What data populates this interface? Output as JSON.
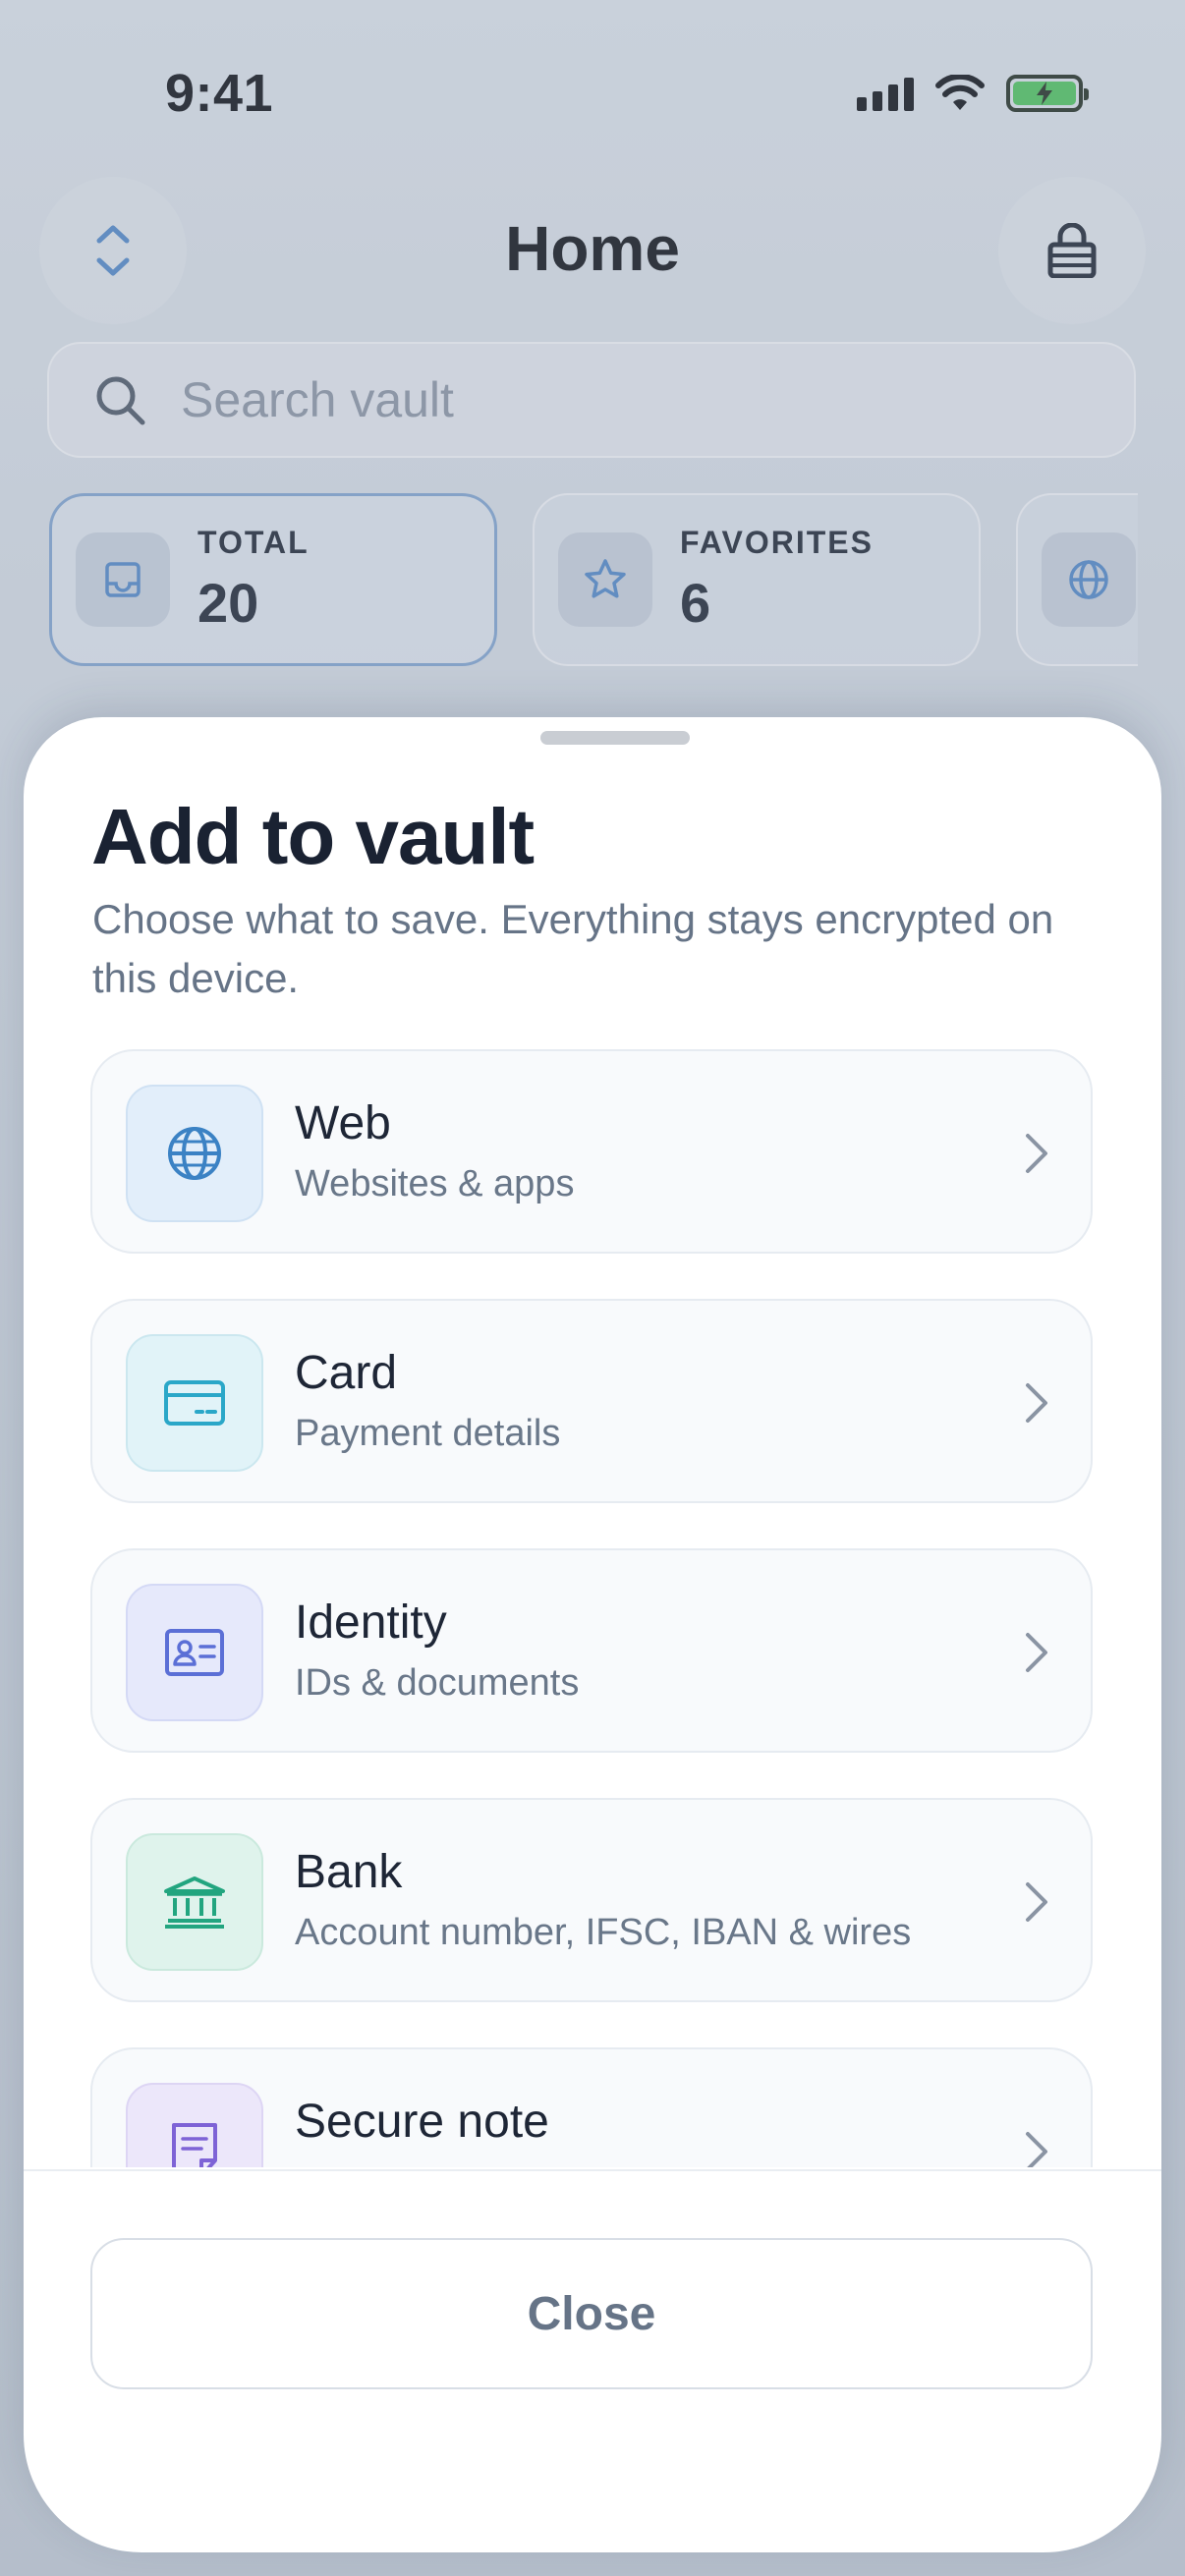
{
  "status_bar": {
    "time": "9:41"
  },
  "header": {
    "title": "Home"
  },
  "search": {
    "placeholder": "Search vault"
  },
  "stats": [
    {
      "label": "TOTAL",
      "value": "20"
    },
    {
      "label": "FAVORITES",
      "value": "6"
    }
  ],
  "sheet": {
    "title": "Add to vault",
    "subtitle": "Choose what to save. Everything stays encrypted on this device.",
    "options": [
      {
        "title": "Web",
        "subtitle": "Websites & apps",
        "icon": "globe-icon",
        "color": "#3b82c4"
      },
      {
        "title": "Card",
        "subtitle": "Payment details",
        "icon": "credit-card-icon",
        "color": "#2aa7c8"
      },
      {
        "title": "Identity",
        "subtitle": "IDs & documents",
        "icon": "id-card-icon",
        "color": "#5b6fd6"
      },
      {
        "title": "Bank",
        "subtitle": "Account number, IFSC, IBAN & wires",
        "icon": "bank-icon",
        "color": "#22a57f"
      },
      {
        "title": "Secure note",
        "subtitle": "",
        "icon": "note-icon",
        "color": "#7e63d6"
      }
    ],
    "close_label": "Close"
  }
}
